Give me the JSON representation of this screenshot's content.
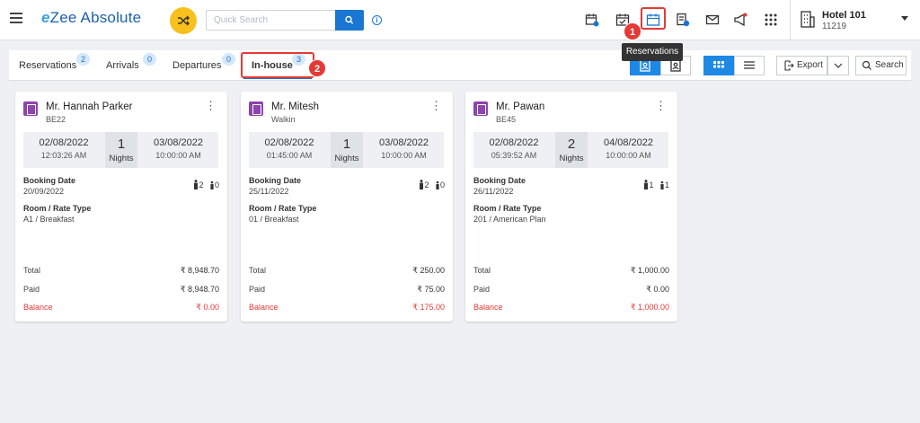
{
  "app": {
    "logo_e": "e",
    "logo_text": "Zee Absolute"
  },
  "search": {
    "placeholder": "Quick Search"
  },
  "info_icon": "i",
  "tooltip": "Reservations",
  "annotations": {
    "one": "1",
    "two": "2"
  },
  "hotel": {
    "name": "Hotel 101",
    "id": "11219"
  },
  "tabs": [
    {
      "label": "Reservations",
      "count": "2"
    },
    {
      "label": "Arrivals",
      "count": "0"
    },
    {
      "label": "Departures",
      "count": "0"
    },
    {
      "label": "In-house",
      "count": "3"
    }
  ],
  "toolbar": {
    "export_label": "Export",
    "search_label": "Search"
  },
  "labels": {
    "nights": "Nights",
    "booking_date": "Booking Date",
    "room_rate": "Room / Rate Type",
    "total": "Total",
    "paid": "Paid",
    "balance": "Balance"
  },
  "cards": [
    {
      "name": "Mr. Hannah Parker",
      "code": "BE22",
      "checkin_date": "02/08/2022",
      "checkin_time": "12:03:26 AM",
      "nights": "1",
      "checkout_date": "03/08/2022",
      "checkout_time": "10:00:00 AM",
      "booking_date": "20/09/2022",
      "adults": "2",
      "children": "0",
      "room": "A1 / Breakfast",
      "total": "₹ 8,948.70",
      "paid": "₹ 8,948.70",
      "balance": "₹ 0.00"
    },
    {
      "name": "Mr. Mitesh",
      "code": "Walkin",
      "checkin_date": "02/08/2022",
      "checkin_time": "01:45:00 AM",
      "nights": "1",
      "checkout_date": "03/08/2022",
      "checkout_time": "10:00:00 AM",
      "booking_date": "25/11/2022",
      "adults": "2",
      "children": "0",
      "room": "01 / Breakfast",
      "total": "₹ 250.00",
      "paid": "₹ 75.00",
      "balance": "₹ 175.00"
    },
    {
      "name": "Mr. Pawan",
      "code": "BE45",
      "checkin_date": "02/08/2022",
      "checkin_time": "05:39:52 AM",
      "nights": "2",
      "checkout_date": "04/08/2022",
      "checkout_time": "10:00:00 AM",
      "booking_date": "26/11/2022",
      "adults": "1",
      "children": "1",
      "room": "201 / American Plan",
      "total": "₹ 1,000.00",
      "paid": "₹ 0.00",
      "balance": "₹ 1,000.00"
    }
  ]
}
